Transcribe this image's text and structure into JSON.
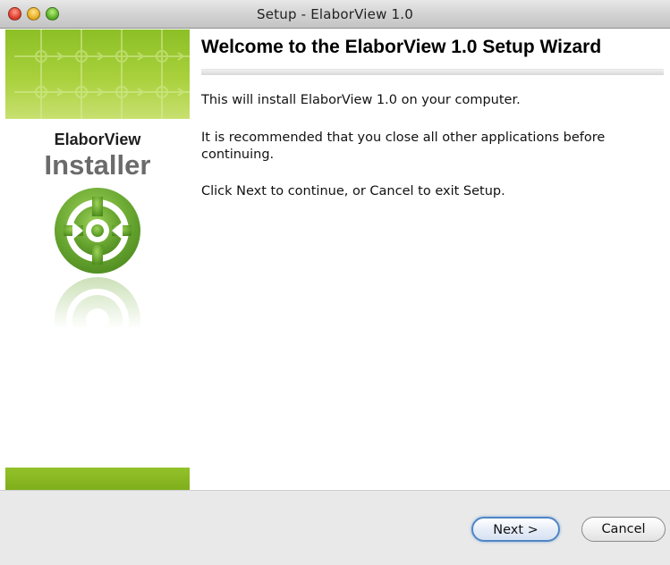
{
  "window": {
    "title": "Setup - ElaborView 1.0"
  },
  "banner": {
    "brand_line1": "ElaborView",
    "brand_line2": "Installer",
    "logo_icon": "elaborview-logo-icon",
    "colors": {
      "accent": "#8cbf26",
      "accent_dark": "#7fae1c",
      "logo_green": "#6aa832"
    }
  },
  "content": {
    "heading": "Welcome to the ElaborView 1.0 Setup Wizard",
    "paragraphs": [
      "This will install ElaborView 1.0 on your computer.",
      "It is recommended that you close all other applications before continuing.",
      "Click Next to continue, or Cancel to exit Setup."
    ]
  },
  "buttons": {
    "next_label": "Next >",
    "cancel_label": "Cancel"
  }
}
